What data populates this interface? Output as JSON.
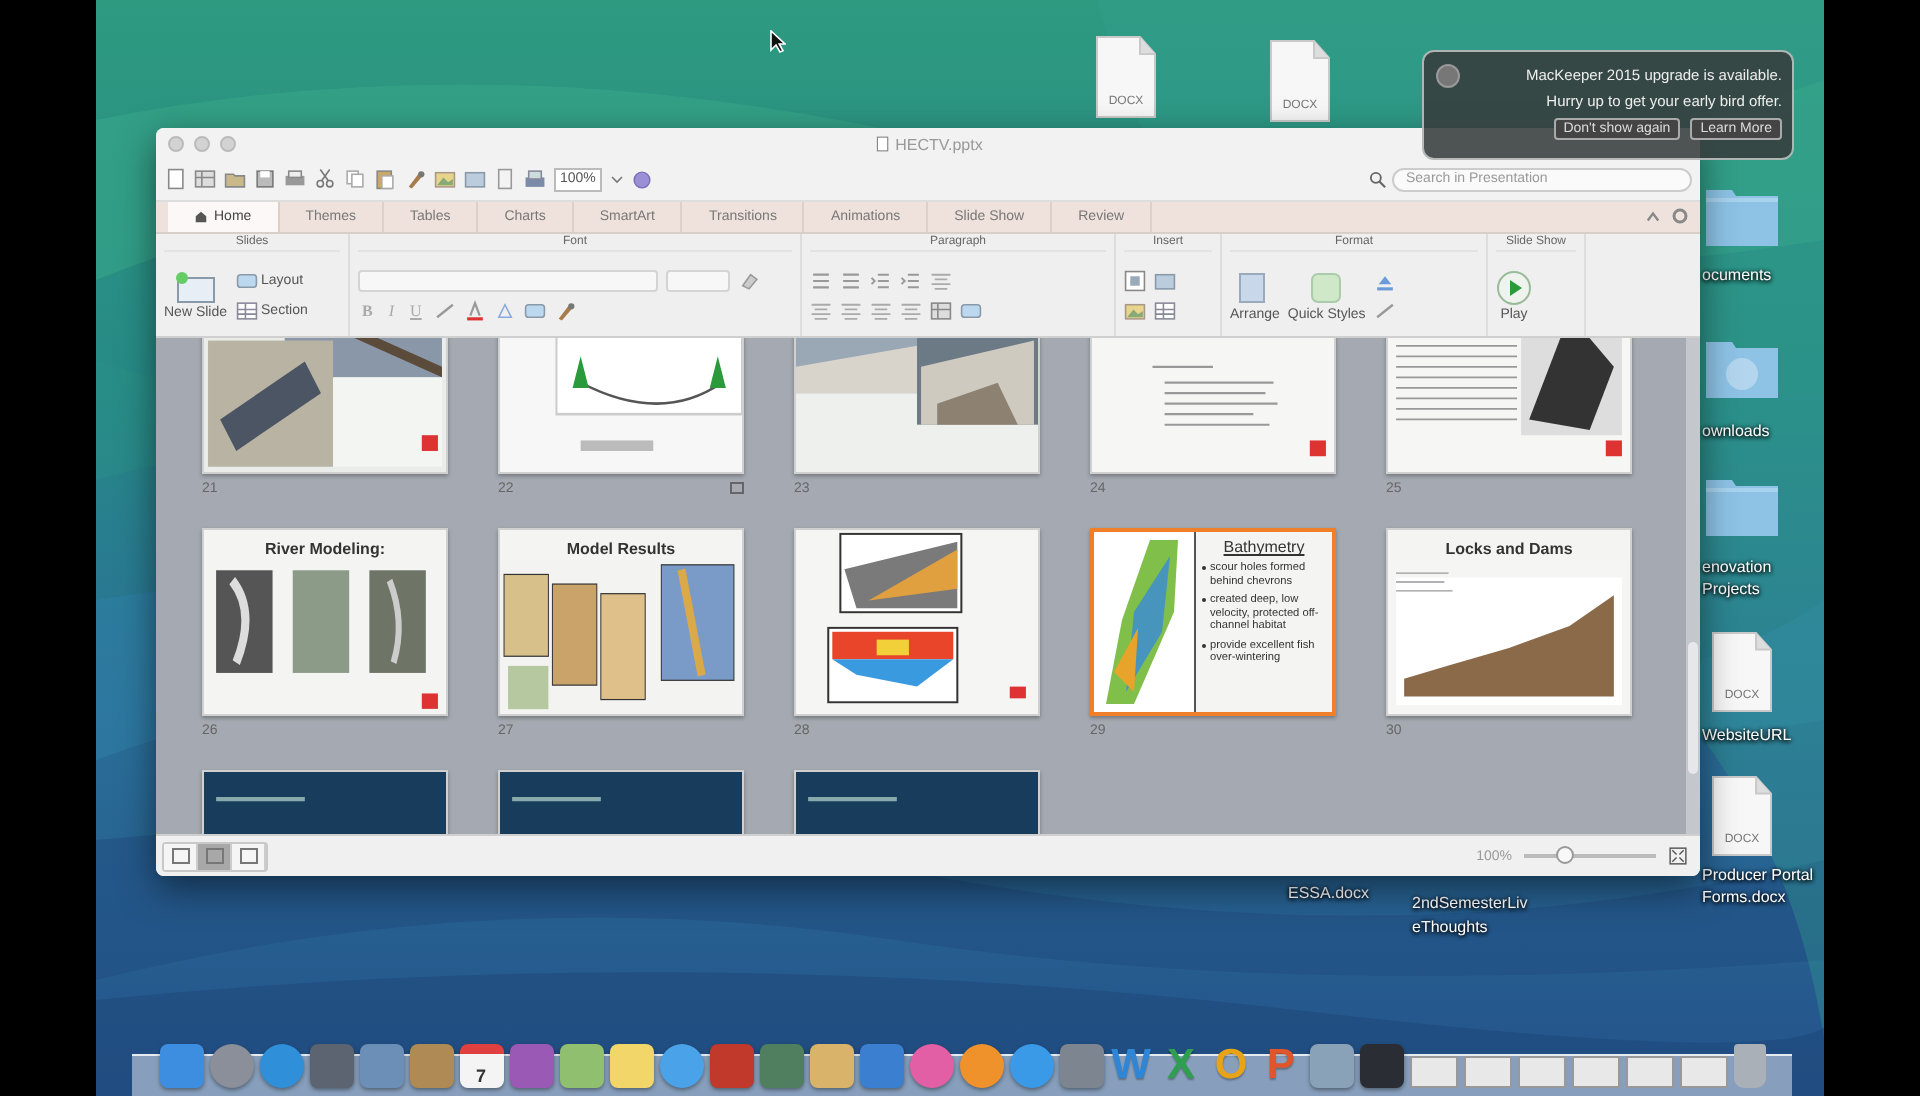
{
  "notification": {
    "lines": [
      "MacKeeper 2015 upgrade is available.",
      "Hurry up to get your early bird offer."
    ],
    "buttons": [
      "Don't show again",
      "Learn More"
    ]
  },
  "desktop_top_files": [
    {
      "kind": "docx",
      "badge": "DOCX"
    },
    {
      "kind": "docx",
      "badge": "DOCX"
    }
  ],
  "side_items": [
    {
      "kind": "folder",
      "lines": [
        "ocuments"
      ]
    },
    {
      "kind": "downloads",
      "lines": [
        "ownloads"
      ]
    },
    {
      "kind": "folder",
      "lines": [
        "enovation",
        "Projects"
      ]
    },
    {
      "kind": "docx",
      "badge": "DOCX",
      "lines": [
        "WebsiteURL"
      ]
    },
    {
      "kind": "docx",
      "badge": "DOCX",
      "lines": [
        "Producer Portal",
        "Forms.docx"
      ]
    }
  ],
  "bottom_labels": [
    {
      "lines": [
        "ESSA.docx"
      ]
    },
    {
      "lines": [
        "2ndSemesterLiv",
        "eThoughts"
      ]
    }
  ],
  "window": {
    "title": "HECTV.pptx",
    "zoom": "100%",
    "search": {
      "placeholder": "Search in Presentation"
    },
    "tabs": [
      {
        "label": "Home",
        "selected": true
      },
      {
        "label": "Themes",
        "selected": false
      },
      {
        "label": "Tables",
        "selected": false
      },
      {
        "label": "Charts",
        "selected": false
      },
      {
        "label": "SmartArt",
        "selected": false
      },
      {
        "label": "Transitions",
        "selected": false
      },
      {
        "label": "Animations",
        "selected": false
      },
      {
        "label": "Slide Show",
        "selected": false
      },
      {
        "label": "Review",
        "selected": false
      }
    ],
    "ribbon": {
      "groups": [
        "Slides",
        "Font",
        "Paragraph",
        "Insert",
        "Format",
        "Slide Show"
      ],
      "new_slide": "New Slide",
      "layout": "Layout",
      "section": "Section",
      "font_buttons": [
        "B",
        "I",
        "U"
      ],
      "arrange": "Arrange",
      "quick_styles": "Quick Styles",
      "play": "Play"
    },
    "slides": [
      {
        "number": "21",
        "kind": "machine",
        "selected": false
      },
      {
        "number": "22",
        "kind": "diagram",
        "selected": false
      },
      {
        "number": "23",
        "kind": "photos",
        "selected": false
      },
      {
        "number": "24",
        "kind": "table",
        "selected": false
      },
      {
        "number": "25",
        "kind": "text-photo",
        "selected": false
      },
      {
        "number": "26",
        "kind": "three-photos",
        "title": "River Modeling:",
        "selected": false
      },
      {
        "number": "27",
        "kind": "maps",
        "title": "Model Results",
        "selected": false
      },
      {
        "number": "28",
        "kind": "heatmap",
        "selected": false
      },
      {
        "number": "29",
        "kind": "bullets",
        "title": "Bathymetry",
        "bullets": [
          "scour holes formed behind chevrons",
          "created deep, low velocity, protected off-channel habitat",
          "provide excellent fish over-wintering"
        ],
        "selected": true
      },
      {
        "number": "30",
        "kind": "profile",
        "title": "Locks and Dams",
        "selected": false
      },
      {
        "kind": "banner",
        "selected": false
      },
      {
        "kind": "banner",
        "selected": false
      },
      {
        "kind": "banner",
        "selected": false
      }
    ],
    "status_bar": {
      "views": [
        {
          "selected": false
        },
        {
          "selected": true
        },
        {
          "selected": false
        }
      ],
      "zoom": "100%",
      "level": 0.3
    }
  },
  "dock": [
    {
      "kind": "app",
      "color": "#3d8ee0"
    },
    {
      "kind": "round",
      "color": "#8a8f99"
    },
    {
      "kind": "round",
      "color": "#2f8fd8"
    },
    {
      "kind": "app",
      "color": "#5b6470"
    },
    {
      "kind": "app",
      "color": "#6c8fb8"
    },
    {
      "kind": "app",
      "color": "#b08a55"
    },
    {
      "kind": "app",
      "color": "#f4f4f4",
      "label": "7"
    },
    {
      "kind": "app",
      "color": "#9b59b6"
    },
    {
      "kind": "app",
      "color": "#8fbf6f"
    },
    {
      "kind": "app",
      "color": "#f2d66a"
    },
    {
      "kind": "round",
      "color": "#4aa3e8"
    },
    {
      "kind": "app",
      "color": "#c0392b"
    },
    {
      "kind": "app",
      "color": "#4f7f5f"
    },
    {
      "kind": "app",
      "color": "#d9b36a"
    },
    {
      "kind": "app",
      "color": "#3a7fd0"
    },
    {
      "kind": "round",
      "color": "#e35fa5"
    },
    {
      "kind": "round",
      "color": "#f0922b"
    },
    {
      "kind": "round",
      "color": "#3a9ae8"
    },
    {
      "kind": "app",
      "color": "#7d8590"
    },
    {
      "kind": "letter",
      "label": "W",
      "color": "#2f86d6"
    },
    {
      "kind": "letter",
      "label": "X",
      "color": "#2e9e4f"
    },
    {
      "kind": "letter",
      "label": "O",
      "color": "#e8a317"
    },
    {
      "kind": "letter",
      "label": "P",
      "color": "#e0562a"
    },
    {
      "kind": "app",
      "color": "#8aa2b8"
    },
    {
      "kind": "app",
      "color": "#2a2d33"
    },
    {
      "kind": "thumb",
      "color": "#e8e8e8"
    },
    {
      "kind": "thumb",
      "color": "#e8e8e8"
    },
    {
      "kind": "thumb",
      "color": "#e8e8e8"
    },
    {
      "kind": "thumb",
      "color": "#e8e8e8"
    },
    {
      "kind": "thumb",
      "color": "#e8e8e8"
    },
    {
      "kind": "thumb",
      "color": "#e8e8e8"
    },
    {
      "kind": "trash",
      "color": "#a9b0b8"
    }
  ]
}
